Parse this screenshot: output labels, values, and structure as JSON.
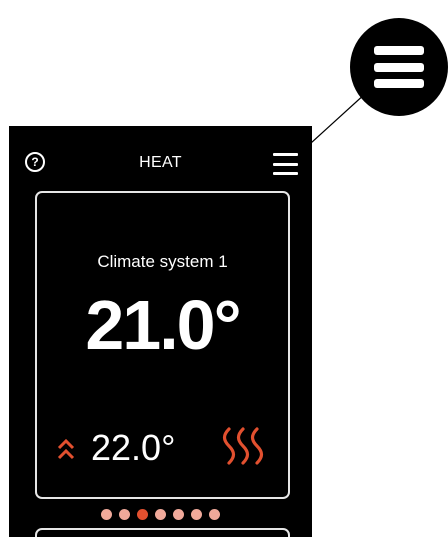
{
  "header": {
    "title": "HEAT",
    "help_glyph": "?"
  },
  "climate_card": {
    "title": "Climate system 1",
    "current_temperature": "21.0°",
    "set_temperature": "22.0°"
  },
  "pager": {
    "count": 7,
    "active_index": 2
  },
  "icons": {
    "help": "help-icon",
    "menu": "menu-icon",
    "increase": "double-chevron-up-icon",
    "heating": "heat-waves-icon"
  },
  "colors": {
    "accent": "#e2502f",
    "inactive_dot": "#f0a99a",
    "screen_background": "#000000",
    "text": "#ffffff"
  }
}
